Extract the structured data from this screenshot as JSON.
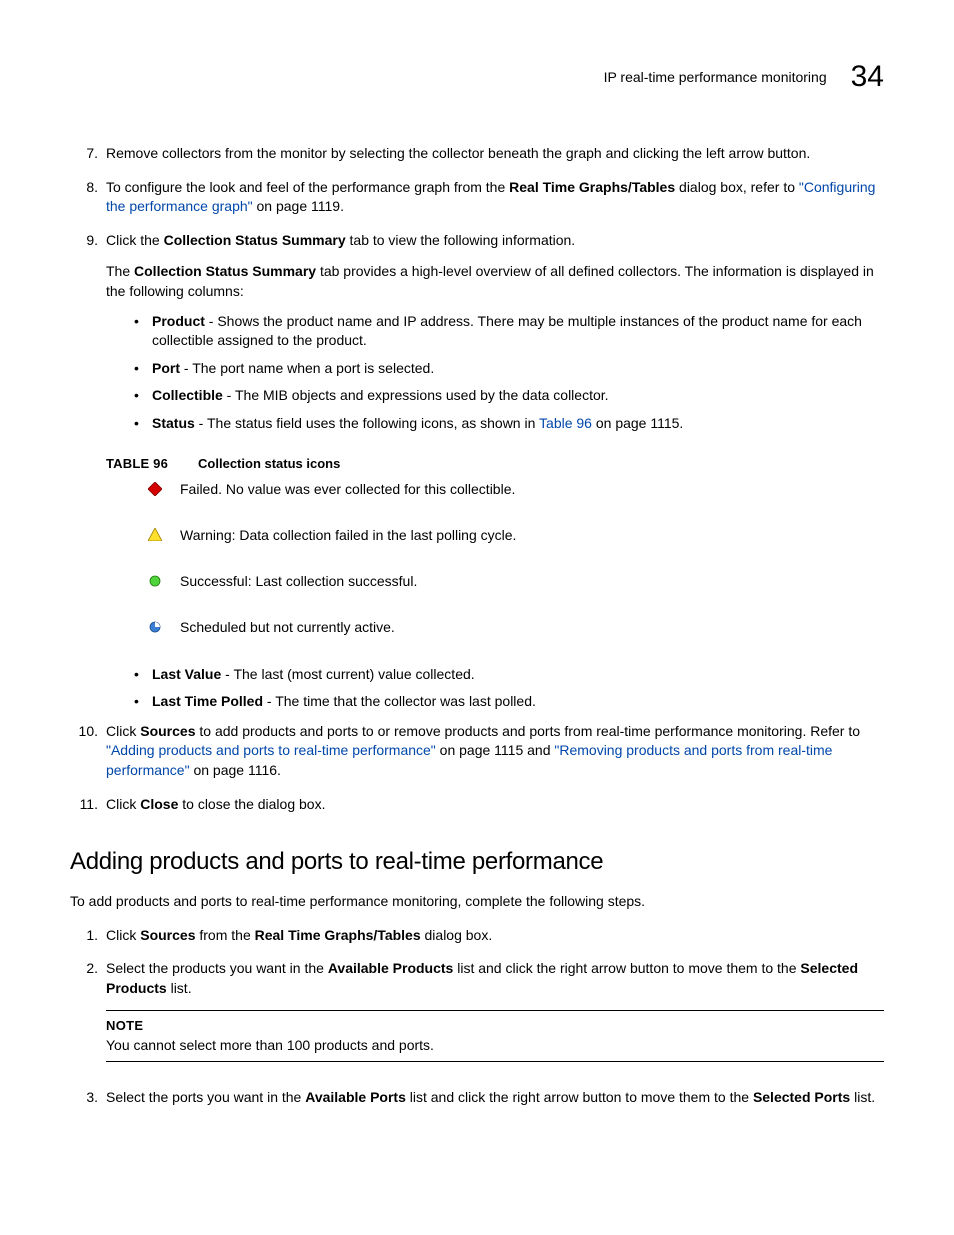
{
  "header": {
    "title": "IP real-time performance monitoring",
    "chapter": "34"
  },
  "steps7to11": {
    "s7": {
      "num": "7.",
      "text": "Remove collectors from the monitor by selecting the collector beneath the graph and clicking the left arrow button."
    },
    "s8": {
      "num": "8.",
      "pre": "To configure the look and feel of the performance graph from the ",
      "bold": "Real Time Graphs/Tables",
      "mid": " dialog box, refer to ",
      "link": "\"Configuring the performance graph\"",
      "post": " on page 1119."
    },
    "s9": {
      "num": "9.",
      "pre": "Click the ",
      "bold": "Collection Status Summary",
      "post": " tab to view the following information.",
      "follow_pre": "The ",
      "follow_bold": "Collection Status Summary",
      "follow_post": " tab provides a high-level overview of all defined collectors. The information is displayed in the following columns:",
      "bullets": {
        "product": {
          "label": "Product",
          "text": " - Shows the product name and IP address. There may be multiple instances of the product name for each collectible assigned to the product."
        },
        "port": {
          "label": "Port",
          "text": " - The port name when a port is selected."
        },
        "collectible": {
          "label": "Collectible",
          "text": " - The MIB objects and expressions used by the data collector."
        },
        "status": {
          "label": "Status",
          "text_pre": " - The status field uses the following icons, as shown in ",
          "link": "Table 96",
          "text_post": " on page 1115."
        },
        "lastvalue": {
          "label": "Last Value",
          "text": " - The last (most current) value collected."
        },
        "lastpolled": {
          "label": "Last Time Polled",
          "text": " - The time that the collector was last polled."
        }
      }
    },
    "table96": {
      "label": "TABLE 96",
      "caption": "Collection status icons",
      "rows": {
        "failed": "Failed. No value was ever collected for this collectible.",
        "warning": "Warning: Data collection failed in the last polling cycle.",
        "success": "Successful: Last collection successful.",
        "scheduled": "Scheduled but not currently active."
      }
    },
    "s10": {
      "num": "10.",
      "pre": "Click ",
      "bold": "Sources",
      "mid": " to add products and ports to or remove products and ports from real-time performance monitoring. Refer to ",
      "link1": "\"Adding products and ports to real-time performance\"",
      "mid2": " on page 1115 and ",
      "link2": "\"Removing products and ports from real-time performance\"",
      "post": " on page 1116."
    },
    "s11": {
      "num": "11.",
      "pre": "Click ",
      "bold": "Close",
      "post": " to close the dialog box."
    }
  },
  "section2": {
    "heading": "Adding products and ports to real-time performance",
    "intro": "To add products and ports to real-time performance monitoring, complete the following steps.",
    "s1": {
      "num": "1.",
      "pre": "Click ",
      "bold1": "Sources",
      "mid": " from the ",
      "bold2": "Real Time Graphs/Tables",
      "post": " dialog box."
    },
    "s2": {
      "num": "2.",
      "pre": "Select the products you want in the ",
      "bold1": "Available Products",
      "mid": " list and click the right arrow button to move them to the ",
      "bold2": "Selected Products",
      "post": " list."
    },
    "note": {
      "label": "NOTE",
      "text": "You cannot select more than 100 products and ports."
    },
    "s3": {
      "num": "3.",
      "pre": "Select the ports you want in the ",
      "bold1": "Available Ports",
      "mid": " list and click the right arrow button to move them to the ",
      "bold2": "Selected Ports",
      "post": " list."
    }
  }
}
